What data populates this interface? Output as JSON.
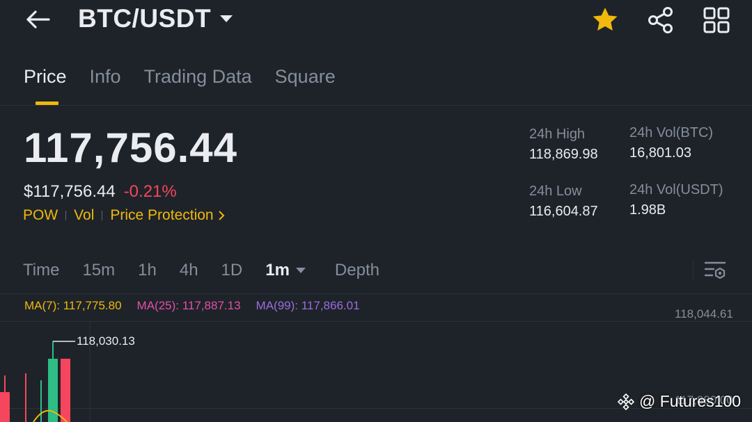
{
  "header": {
    "pair": "BTC/USDT",
    "icons": [
      "back-arrow-icon",
      "caret-down-icon",
      "star-icon",
      "share-icon",
      "grid-apps-icon"
    ],
    "star_color": "#f0b90b"
  },
  "tabs": [
    {
      "label": "Price",
      "active": true
    },
    {
      "label": "Info"
    },
    {
      "label": "Trading Data"
    },
    {
      "label": "Square"
    }
  ],
  "price": {
    "last": "117,756.44",
    "usd": "$117,756.44",
    "change": "-0.21%",
    "change_color": "#f6465d"
  },
  "tags": [
    "POW",
    "Vol",
    "Price Protection"
  ],
  "stats": {
    "high_label": "24h High",
    "high_value": "118,869.98",
    "low_label": "24h Low",
    "low_value": "116,604.87",
    "vol_btc_label": "24h Vol(BTC)",
    "vol_btc_value": "16,801.03",
    "vol_usdt_label": "24h Vol(USDT)",
    "vol_usdt_value": "1.98B"
  },
  "intervals": [
    "Time",
    "15m",
    "1h",
    "4h",
    "1D",
    "1m",
    "Depth"
  ],
  "active_interval": "1m",
  "ma": {
    "ma7": "MA(7): 117,775.80",
    "ma25": "MA(25): 117,887.13",
    "ma99": "MA(99): 117,866.01"
  },
  "chart": {
    "axis_top": "118,044.61",
    "axis_bottom": "117,880.00",
    "high_marker": "118,030.13",
    "up_color": "#2ebd85",
    "down_color": "#f6465d"
  },
  "watermark": "@ Futures100"
}
